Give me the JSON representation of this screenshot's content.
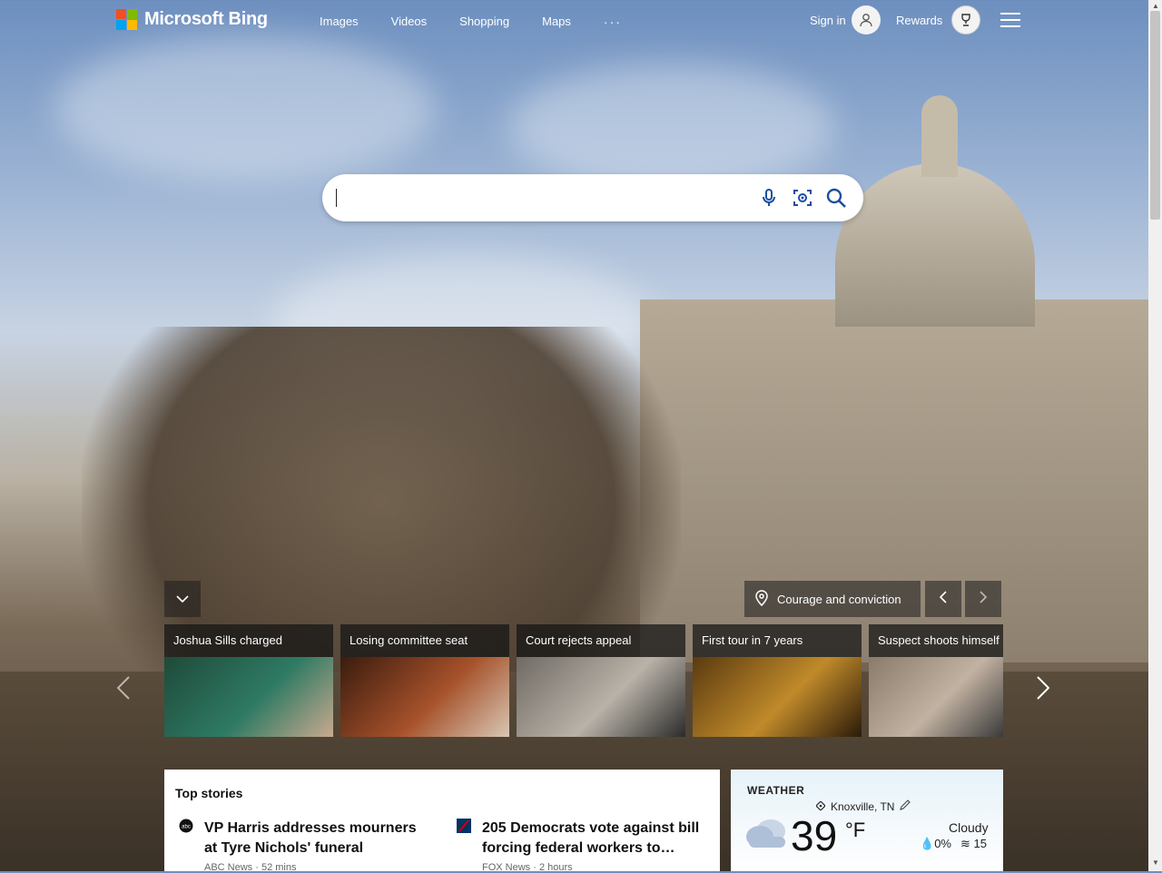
{
  "header": {
    "brand": "Microsoft Bing",
    "logo_colors": [
      "#f25022",
      "#7fba00",
      "#00a4ef",
      "#ffb900"
    ],
    "nav": [
      "Images",
      "Videos",
      "Shopping",
      "Maps"
    ],
    "more_label": "···",
    "signin_label": "Sign in",
    "rewards_label": "Rewards"
  },
  "search": {
    "value": "",
    "mic_icon": "mic-icon",
    "visual_icon": "visual-search-icon",
    "search_icon": "search-icon"
  },
  "image_caption": {
    "label": "Courage and conviction",
    "icon": "location-pin-icon"
  },
  "carousel": {
    "items": [
      {
        "title": "Joshua Sills charged",
        "colors": [
          "#1f4a3a",
          "#2e7a63",
          "#c9a98e"
        ]
      },
      {
        "title": "Losing committee seat",
        "colors": [
          "#3a1c0e",
          "#a6512a",
          "#d8c7b4"
        ]
      },
      {
        "title": "Court rejects appeal",
        "colors": [
          "#6f6a64",
          "#b9b2a8",
          "#2b2b2b"
        ]
      },
      {
        "title": "First tour in 7 years",
        "colors": [
          "#5a3a10",
          "#c08a2a",
          "#2a1a0a"
        ]
      },
      {
        "title": "Suspect shoots himself",
        "colors": [
          "#8a7a6a",
          "#c2b2a2",
          "#3a3a3a"
        ]
      }
    ]
  },
  "top_stories": {
    "heading": "Top stories",
    "items": [
      {
        "title": "VP Harris addresses mourners at Tyre Nichols' funeral",
        "source": "ABC News · 52 mins",
        "logo_color": "#111111"
      },
      {
        "title": "205 Democrats vote against bill forcing federal workers to…",
        "source": "FOX News · 2 hours",
        "logo_color": "#003366"
      }
    ]
  },
  "weather": {
    "heading": "WEATHER",
    "location": "Knoxville, TN",
    "temp": "39",
    "unit": "°F",
    "condition": "Cloudy",
    "precip": "0%",
    "wind": "15"
  }
}
